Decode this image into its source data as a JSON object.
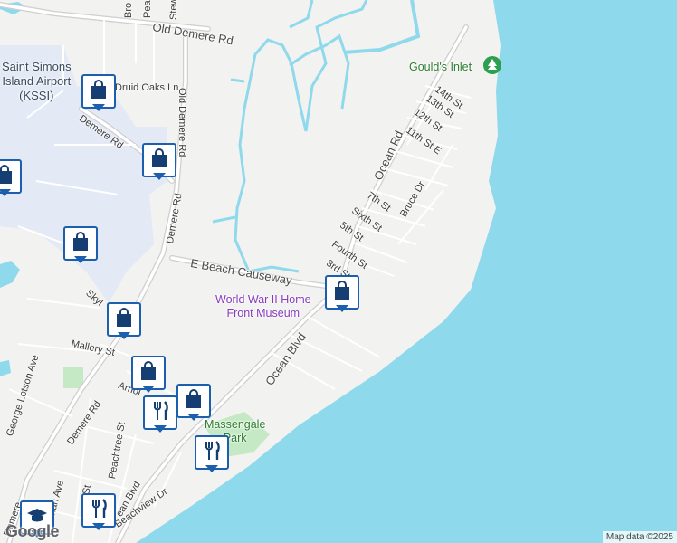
{
  "colors": {
    "water": "#8fd9ec",
    "land": "#f2f2f0",
    "airport": "#e3e9f5",
    "road": "#ffffff",
    "major_road": "#c8c8c8",
    "park": "#c5e8c5",
    "pin_border": "#1b5fae",
    "pin_icon": "#153f73",
    "poi": "#8a3ac0"
  },
  "labels": {
    "airport": "Saint Simons\nIsland Airport\n(KSSI)",
    "old_demere_rd": "Old Demere Rd",
    "druid_oaks_ln": "Druid Oaks Ln",
    "demere_rd_left": "Demere Rd",
    "demere_rd_mid": "Demere Rd",
    "demere_rd_bottom": "Demere Rd",
    "demere_rd_top": "Old Demere Rd",
    "e_beach_causeway": "E Beach Causeway",
    "ocean_rd": "Ocean Rd",
    "ocean_blvd": "Ocean Blvd",
    "goulds_inlet": "Gould's Inlet",
    "st14": "14th St",
    "st13": "13th St",
    "st12": "12th St",
    "st11": "11th St E",
    "st7": "7th St",
    "sixth": "Sixth St",
    "bruce": "Bruce Dr",
    "st5": "5th St",
    "fourth": "Fourth St",
    "st3": "3rd St",
    "museum": "World War II Home\nFront Museum",
    "mallery": "Mallery St",
    "george_lotson": "George Lotson Ave",
    "skyl": "Skyl",
    "arnold": "Arnol",
    "massengale": "Massengale\nPark",
    "peachtree": "Peachtree St",
    "beachview": "Beachview Dr",
    "ean_blvd": "ean Blvd",
    "ge_st": "ge St",
    "erman_ave": "erman Ave",
    "demere_corner": "Demere",
    "broc": "Bro",
    "peac": "Pea",
    "stew": "Stew"
  },
  "pins": [
    {
      "name": "shopping-pin-airport",
      "icon": "shopping-bag-icon"
    },
    {
      "name": "shopping-pin-left",
      "icon": "shopping-bag-icon"
    },
    {
      "name": "shopping-pin-demere",
      "icon": "shopping-bag-icon"
    },
    {
      "name": "shopping-pin-skyline",
      "icon": "shopping-bag-icon"
    },
    {
      "name": "shopping-pin-mallery",
      "icon": "shopping-bag-icon"
    },
    {
      "name": "shopping-pin-arnold",
      "icon": "shopping-bag-icon"
    },
    {
      "name": "shopping-pin-cluster",
      "icon": "shopping-bag-icon"
    },
    {
      "name": "restaurant-pin-cluster",
      "icon": "fork-knife-icon"
    },
    {
      "name": "restaurant-pin-massengale",
      "icon": "fork-knife-icon"
    },
    {
      "name": "restaurant-pin-bottom",
      "icon": "fork-knife-icon"
    },
    {
      "name": "school-pin-bottom",
      "icon": "graduation-cap-icon"
    },
    {
      "name": "shopping-pin-museum",
      "icon": "shopping-bag-icon"
    }
  ],
  "branding": {
    "logo": "Google",
    "attribution": "Map data ©2025"
  }
}
